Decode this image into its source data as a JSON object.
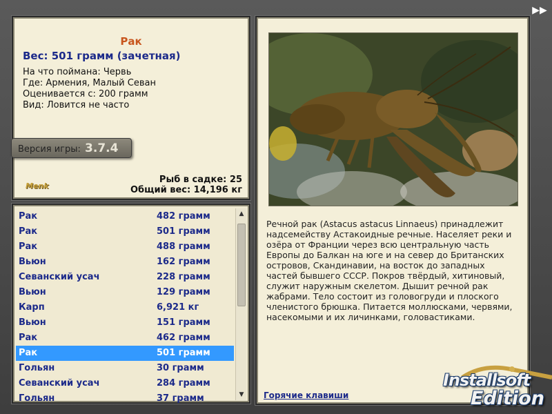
{
  "info": {
    "fish_name": "Рак",
    "fish_weight": "Вес: 501 грамм (зачетная)",
    "caught_on": "На что поймана: Червь",
    "location": "Где: Армения, Малый Севан",
    "valued_from": "Оценивается с: 200 грамм",
    "kind": "Вид: Ловится не часто",
    "version_label": "Версия игры:",
    "version_number": "3.7.4",
    "logo_small": "Menk",
    "fish_in_keepnet": "Рыб в садке: 25",
    "total_weight": "Общий вес: 14,196 кг"
  },
  "catch_list": {
    "rows": [
      {
        "name": "Рак",
        "weight": "482 грамм",
        "selected": false
      },
      {
        "name": "Рак",
        "weight": "501 грамм",
        "selected": false
      },
      {
        "name": "Рак",
        "weight": "488 грамм",
        "selected": false
      },
      {
        "name": "Вьюн",
        "weight": "162 грамм",
        "selected": false
      },
      {
        "name": "Севанский усач",
        "weight": "228 грамм",
        "selected": false
      },
      {
        "name": "Вьюн",
        "weight": "129 грамм",
        "selected": false
      },
      {
        "name": "Карп",
        "weight": "6,921 кг",
        "selected": false
      },
      {
        "name": "Вьюн",
        "weight": "151 грамм",
        "selected": false
      },
      {
        "name": "Рак",
        "weight": "462 грамм",
        "selected": false
      },
      {
        "name": "Рак",
        "weight": "501 грамм",
        "selected": true
      },
      {
        "name": "Гольян",
        "weight": "30 грамм",
        "selected": false
      },
      {
        "name": "Севанский усач",
        "weight": "284 грамм",
        "selected": false
      },
      {
        "name": "Гольян",
        "weight": "37 грамм",
        "selected": false
      }
    ]
  },
  "description": {
    "text": "Речной рак (Astacus astacus Linnaeus) принадлежит надсемейству Астакоидные речные. Населяет реки и озёра от Франции через всю центральную часть Европы до Балкан на юге и на север до Британских островов, Скандинавии, на восток до западных частей бывшего СССР. Покров твёрдый, хитиновый, служит наружным скелетом. Дышит речной рак жабрами. Тело состоит из головогруди и плоского членистого брюшка. Питается моллюсками, червями, насекомыми и их личинками, головастиками.",
    "hotkeys_link": "Горячие клавиши"
  },
  "watermark": {
    "line1": "Installsoft",
    "line2": "Edition"
  },
  "icons": {
    "fast_forward": "fast-forward-icon",
    "scroll_up": "chevron-up-icon",
    "scroll_down": "chevron-down-icon"
  },
  "colors": {
    "panel_bg": "#f4efd9",
    "fish_name": "#c8561e",
    "list_text": "#1c2a8a",
    "selected_row": "#3399ff"
  }
}
